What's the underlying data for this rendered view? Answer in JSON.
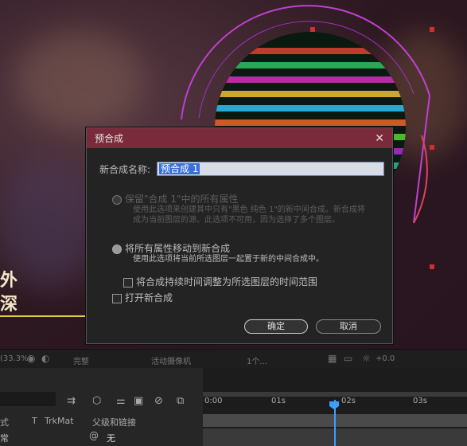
{
  "scene": {
    "overlay_text_1": "外",
    "overlay_text_2": "深"
  },
  "dialog": {
    "title": "预合成",
    "close": "✕",
    "name_label": "新合成名称:",
    "name_value": "预合成 1",
    "option1_label": "保留\"合成 1\"中的所有属性",
    "option1_desc": "使用此选项来创建其中只有\"黑色 纯色 1\"的新中间合成。新合成将成为当前图层的源。此选项不可用，因为选择了多个图层。",
    "option2_label": "将所有属性移动到新合成",
    "option2_desc": "使用此选项将当前所选图层一起置于新的中间合成中。",
    "adjust_label": "将合成持续时间调整为所选图层的时间范围",
    "open_label": "打开新合成",
    "ok": "确定",
    "cancel": "取消"
  },
  "toolbar": {
    "zoom": "(33.3%)",
    "quality": "完整",
    "camera": "活动摄像机",
    "views": "1个...",
    "exposure": "+0.0"
  },
  "timeline": {
    "ticks": [
      "0:00",
      "01s",
      "02s",
      "03s"
    ],
    "col_mode": "式",
    "col_t": "T",
    "col_trkmat": "TrkMat",
    "col_parent": "父级和链接",
    "mode_value": "常",
    "parent_value": "无"
  }
}
